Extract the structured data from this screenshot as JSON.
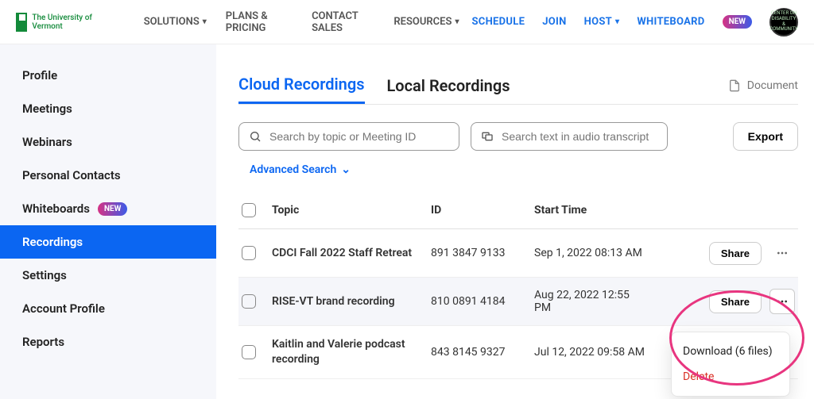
{
  "topnav": {
    "logo_text": "The University of Vermont",
    "left": [
      {
        "label": "SOLUTIONS",
        "caret": true
      },
      {
        "label": "PLANS & PRICING",
        "caret": false
      },
      {
        "label": "CONTACT SALES",
        "caret": false
      },
      {
        "label": "RESOURCES",
        "caret": true
      }
    ],
    "right": [
      {
        "label": "SCHEDULE",
        "caret": false
      },
      {
        "label": "JOIN",
        "caret": false
      },
      {
        "label": "HOST",
        "caret": true
      },
      {
        "label": "WHITEBOARD",
        "caret": false
      }
    ],
    "new_badge": "NEW",
    "avatar_text": "CENTER ON DISABILITY & COMMUNITY"
  },
  "sidebar": {
    "items": [
      {
        "label": "Profile"
      },
      {
        "label": "Meetings"
      },
      {
        "label": "Webinars"
      },
      {
        "label": "Personal Contacts"
      },
      {
        "label": "Whiteboards",
        "badge": "NEW"
      },
      {
        "label": "Recordings",
        "active": true
      },
      {
        "label": "Settings"
      },
      {
        "label": "Account Profile"
      },
      {
        "label": "Reports"
      }
    ]
  },
  "tabs": {
    "items": [
      {
        "label": "Cloud Recordings",
        "active": true
      },
      {
        "label": "Local Recordings",
        "active": false
      }
    ],
    "document_label": "Document"
  },
  "search": {
    "topic_placeholder": "Search by topic or Meeting ID",
    "transcript_placeholder": "Search text in audio transcript",
    "export_label": "Export",
    "advanced_label": "Advanced Search"
  },
  "table": {
    "headers": {
      "topic": "Topic",
      "id": "ID",
      "start": "Start Time"
    },
    "share_label": "Share",
    "rows": [
      {
        "topic": "CDCI Fall 2022 Staff Retreat",
        "id": "891 3847 9133",
        "start": "Sep 1, 2022 08:13 AM"
      },
      {
        "topic": "RISE-VT brand recording",
        "id": "810 0891 4184",
        "start": "Aug 22, 2022 12:55 PM"
      },
      {
        "topic": "Kaitlin and Valerie podcast recording",
        "id": "843 8145 9327",
        "start": "Jul 12, 2022 09:58 AM"
      }
    ]
  },
  "dropdown": {
    "download_label": "Download (6 files)",
    "delete_label": "Delete"
  }
}
